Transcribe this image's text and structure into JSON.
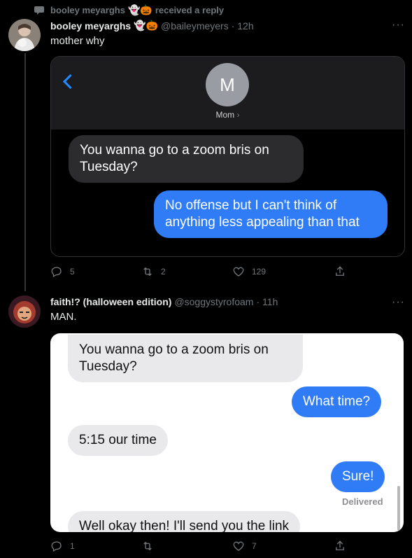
{
  "context": {
    "text": "booley meyarghs",
    "emoji": "👻🎃",
    "suffix": "received a reply"
  },
  "tweet1": {
    "name": "booley meyarghs",
    "emoji": "👻🎃",
    "handle": "@baileymeyers",
    "time": "· 12h",
    "more": "···",
    "text": "mother why",
    "media": {
      "back_icon": "chevron-left-icon",
      "contact_initial": "M",
      "contact_name": "Mom",
      "messages": [
        {
          "dir": "in",
          "text": "You wanna go to a  zoom bris on Tuesday?"
        },
        {
          "dir": "out",
          "text": "No offense but I can't think of anything less appealing than that"
        }
      ]
    },
    "actions": {
      "replies": "5",
      "retweets": "2",
      "likes": "129"
    }
  },
  "tweet2": {
    "name": "faith!? (halloween edition)",
    "handle": "@soggystyrofoam",
    "time": "· 11h",
    "more": "···",
    "text": "MAN.",
    "media": {
      "messages": [
        {
          "dir": "in",
          "text": "You wanna go to a  zoom bris on Tuesday?"
        },
        {
          "dir": "out",
          "text": "What time?"
        },
        {
          "dir": "in",
          "text": "5:15 our time"
        },
        {
          "dir": "out",
          "text": "Sure!"
        },
        {
          "dir": "in",
          "text": "Well okay then! I'll send you the link"
        }
      ],
      "status": "Delivered"
    },
    "actions": {
      "replies": "1",
      "retweets": "",
      "likes": "7"
    }
  },
  "colors": {
    "bg": "#000000",
    "imessage_blue": "#2f7cf6",
    "muted": "#71767b"
  }
}
